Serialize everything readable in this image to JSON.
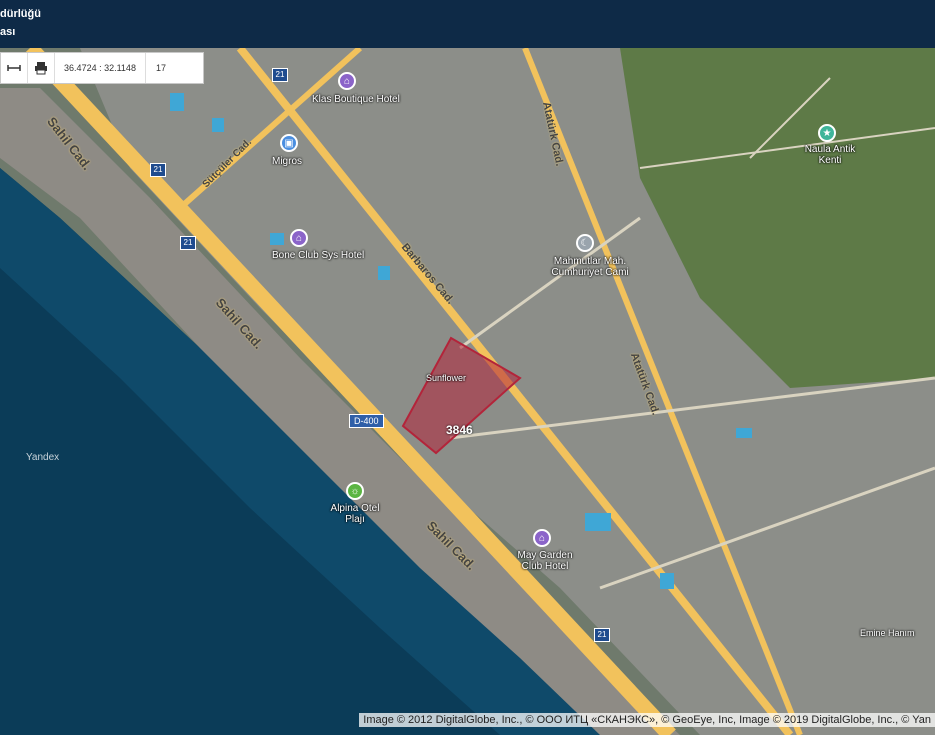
{
  "header": {
    "title_line1": "dürlüğü",
    "title_line2": "ası"
  },
  "toolbar": {
    "measure_icon": "ruler-icon",
    "print_icon": "print-icon",
    "coordinates": "36.4724 : 32.1148",
    "zoom": "17"
  },
  "map": {
    "parcel_number": "3846",
    "watermark": "Yandex",
    "road_labels": [
      "Sahil Cad.",
      "Sahil Cad.",
      "Sahil Cad.",
      "Barbaros Cad.",
      "Atatürk Cad.",
      "Atatürk Cad.",
      "Sütçüler Cad.",
      "D-400"
    ],
    "pois": [
      {
        "label": "Klas Boutique Hotel",
        "icon": "bed-icon",
        "color": "#8b64c9"
      },
      {
        "label": "Migros",
        "icon": "shop-icon",
        "color": "#4a8ee0"
      },
      {
        "label": "Bone Club Sys Hotel",
        "icon": "bed-icon",
        "color": "#8b64c9"
      },
      {
        "label": "Mahmutlar Mah. Cumhuriyet Cami",
        "icon": "mosque-icon",
        "color": "#9aa4ad"
      },
      {
        "label": "Naula Antik Kenti",
        "icon": "star-icon",
        "color": "#3fb59a"
      },
      {
        "label": "Alpina Otel Plajı",
        "icon": "beach-icon",
        "color": "#5bb543"
      },
      {
        "label": "May Garden Club Hotel",
        "icon": "bed-icon",
        "color": "#8b64c9"
      },
      {
        "label": "Sunflower",
        "icon": "bed-icon",
        "color": "#8b64c9"
      },
      {
        "label": "Emine Hanım",
        "icon": "bed-icon",
        "color": "#8b64c9"
      }
    ],
    "attribution": "Image © 2012 DigitalGlobe, Inc., © ООО ИТЦ «СКАНЭКС», © GeoEye, Inc, Image © 2019 DigitalGlobe, Inc., © Yan"
  },
  "colors": {
    "header_bg": "#0e2a47",
    "road": "#f2c25c",
    "sea": "#0b3c58",
    "parcel": "#b3243a"
  }
}
